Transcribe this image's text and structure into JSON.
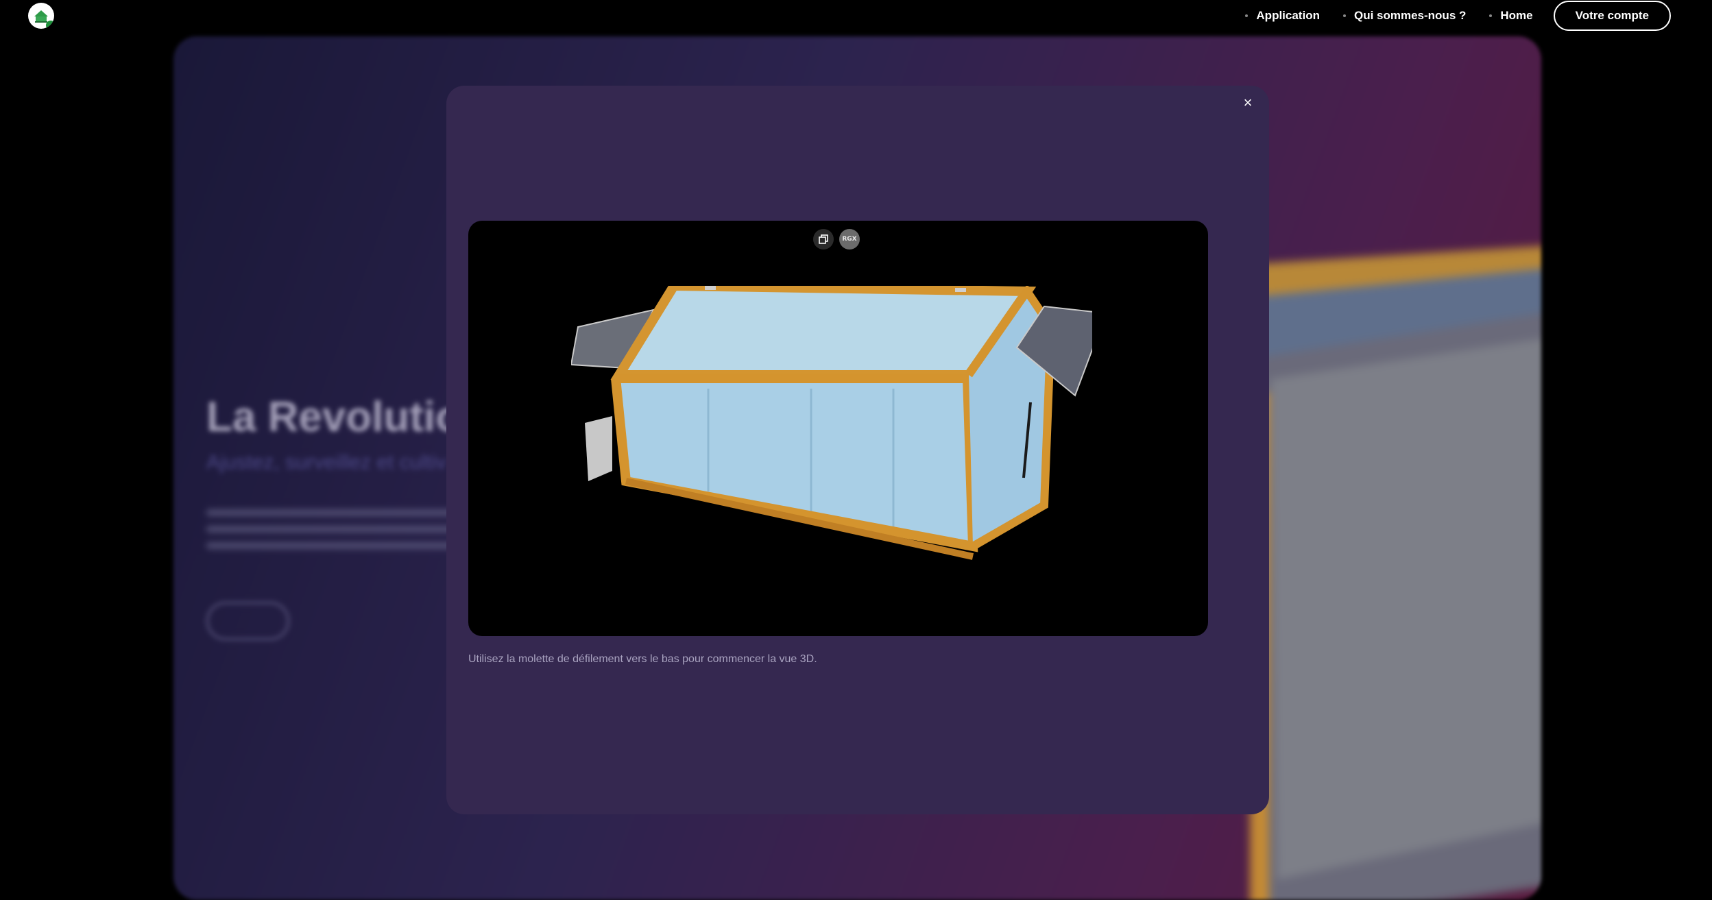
{
  "nav": {
    "items": [
      {
        "label": "Application"
      },
      {
        "label": "Qui sommes-nous ?"
      },
      {
        "label": "Home"
      }
    ],
    "account_label": "Votre compte"
  },
  "hero": {
    "title": "La Revolutio",
    "subtitle": "Ajustez, surveillez et cultiv"
  },
  "modal": {
    "close_label": "×",
    "viewer_badge": "RGX",
    "hint": "Utilisez la molette de défilement vers le bas pour commencer la vue 3D."
  },
  "colors": {
    "modal_bg": "#352850",
    "viewer_bg": "#000000",
    "frame_wood": "#d4942e",
    "glass": "#a9cfe6"
  }
}
